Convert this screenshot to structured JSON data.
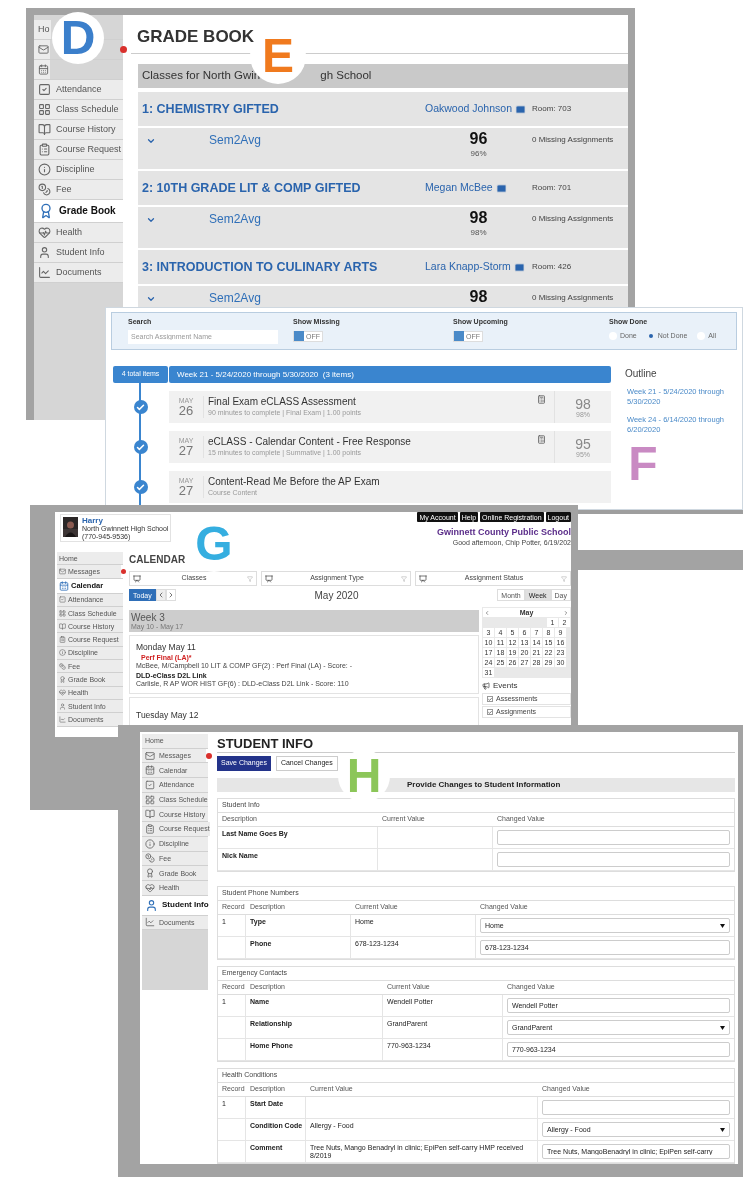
{
  "callouts": [
    {
      "letter": "D",
      "color": "#3b7fcb"
    },
    {
      "letter": "E",
      "color": "#f07a1e"
    },
    {
      "letter": "F",
      "color": "#c98ac3"
    },
    {
      "letter": "G",
      "color": "#35aee0"
    },
    {
      "letter": "H",
      "color": "#8cc659"
    }
  ],
  "gradebook": {
    "sidebar": [
      {
        "label": "Ho",
        "selected": false,
        "alert": false
      },
      {
        "selected": false,
        "alert": true
      },
      {
        "selected": false,
        "alert": false
      },
      {
        "label": "Attendance",
        "selected": false,
        "alert": false
      },
      {
        "label": "Class Schedule",
        "selected": false,
        "alert": false
      },
      {
        "label": "Course History",
        "selected": false,
        "alert": false
      },
      {
        "label": "Course Request",
        "selected": false,
        "alert": false
      },
      {
        "label": "Discipline",
        "selected": false,
        "alert": false
      },
      {
        "label": "Fee",
        "selected": false,
        "alert": false
      },
      {
        "label": "Grade Book",
        "selected": true,
        "alert": false
      },
      {
        "label": "Health",
        "selected": false,
        "alert": false
      },
      {
        "label": "Student Info",
        "selected": false,
        "alert": false
      },
      {
        "label": "Documents",
        "selected": false,
        "alert": false
      }
    ],
    "title": "GRADE BOOK",
    "header_parts": [
      "Classes for North Gwin",
      "gh School"
    ],
    "classes": [
      {
        "title": "1: CHEMISTRY GIFTED",
        "teacher": "Oakwood Johnson",
        "room": "Room: 703",
        "term": "Sem2Avg",
        "score": "96",
        "percent": "96%",
        "missing": "0 Missing Assignments"
      },
      {
        "title": "2: 10TH GRADE LIT & COMP GIFTED",
        "teacher": "Megan McBee",
        "room": "Room: 701",
        "term": "Sem2Avg",
        "score": "98",
        "percent": "98%",
        "missing": "0 Missing Assignments"
      },
      {
        "title": "3: INTRODUCTION TO CULINARY ARTS",
        "teacher": "Lara Knapp-Storm",
        "room": "Room: 426",
        "term": "Sem2Avg",
        "score": "98",
        "missing": "0 Missing Assignments"
      }
    ]
  },
  "assignments": {
    "search": {
      "label": "Search",
      "placeholder": "Search Assignment Name"
    },
    "toggles": [
      {
        "label": "Show Missing",
        "on": false,
        "text": "OFF"
      },
      {
        "label": "Show Upcoming",
        "on": false,
        "text": "OFF"
      }
    ],
    "show_done": {
      "label": "Show Done",
      "options": [
        {
          "label": "Done",
          "selected": false
        },
        {
          "label": "Not Done",
          "selected": true
        },
        {
          "label": "All",
          "selected": false
        }
      ]
    },
    "total_button": "4 total items",
    "week": "Week 21 - 5/24/2020 through 5/30/2020  (3 items)",
    "items": [
      {
        "month": "MAY",
        "day": "26",
        "title": "Final Exam eCLASS Assessment",
        "details": "90 minutes to complete | Final Exam | 1.00 points",
        "score": "98",
        "percent": "98%",
        "done": true
      },
      {
        "month": "MAY",
        "day": "27",
        "title": "eCLASS - Calendar Content - Free Response",
        "details": "15 minutes to complete | Summative | 1.00 points",
        "score": "95",
        "percent": "95%",
        "done": true
      },
      {
        "month": "MAY",
        "day": "27",
        "title": "Content-Read Me Before the AP Exam",
        "details": "Course Content",
        "done": true
      }
    ],
    "outline": {
      "title": "Outline",
      "links": [
        "Week 21 - 5/24/2020 through 5/30/2020",
        "Week 24 - 6/14/2020 through 6/20/2020"
      ]
    }
  },
  "calendar": {
    "user": {
      "name": "Harry",
      "school": "North Gwinnett High School",
      "phone": "(770-945-9536)"
    },
    "top_links": [
      "My Account",
      "Help",
      "Online Registration",
      "Logout"
    ],
    "district": "Gwinnett County Public School",
    "greeting": "Good afternoon, Chip Potter, 6/19/202",
    "sidebar": [
      {
        "label": "Home",
        "selected": false,
        "alert": false
      },
      {
        "label": "Messages",
        "selected": false,
        "alert": true
      },
      {
        "label": "Calendar",
        "selected": true,
        "alert": false
      },
      {
        "label": "Attendance",
        "selected": false,
        "alert": false
      },
      {
        "label": "Class Schedule",
        "selected": false,
        "alert": false
      },
      {
        "label": "Course History",
        "selected": false,
        "alert": false
      },
      {
        "label": "Course Request",
        "selected": false,
        "alert": false
      },
      {
        "label": "Discipline",
        "selected": false,
        "alert": false
      },
      {
        "label": "Fee",
        "selected": false,
        "alert": false
      },
      {
        "label": "Grade Book",
        "selected": false,
        "alert": false
      },
      {
        "label": "Health",
        "selected": false,
        "alert": false
      },
      {
        "label": "Student Info",
        "selected": false,
        "alert": false
      },
      {
        "label": "Documents",
        "selected": false,
        "alert": false
      }
    ],
    "title": "CALENDAR",
    "filters": [
      "Classes",
      "Assignment Type",
      "Assignment Status"
    ],
    "today": "Today",
    "month": "May 2020",
    "views": [
      {
        "label": "Month",
        "selected": false
      },
      {
        "label": "Week",
        "selected": true
      },
      {
        "label": "Day",
        "selected": false
      }
    ],
    "week": {
      "title": "Week 3",
      "range": "May 10 - May 17"
    },
    "days": [
      {
        "title": "Monday May 11",
        "events": [
          {
            "title": "Perf Final (LA)*",
            "detail": "McBee, M/Campbell 10 LIT & COMP GF(2) : Perf Final (LA) - Score: -",
            "flagged": true
          },
          {
            "title": "DLD-eClass D2L Link",
            "detail": "Carlisle, R AP WOR HIST GF(6) : DLD-eClass D2L Link - Score: 110",
            "flagged": false
          }
        ]
      },
      {
        "title": "Tuesday May 12"
      }
    ],
    "mini_calendar": {
      "month": "May",
      "weeks": [
        [
          "1",
          "2"
        ],
        [
          "3",
          "4",
          "5",
          "6",
          "7",
          "8",
          "9"
        ],
        [
          "10",
          "11",
          "12",
          "13",
          "14",
          "15",
          "16"
        ],
        [
          "17",
          "18",
          "19",
          "20",
          "21",
          "22",
          "23"
        ],
        [
          "24",
          "25",
          "26",
          "27",
          "28",
          "29",
          "30"
        ],
        [
          "31"
        ]
      ]
    },
    "events_panel": {
      "title": "Events",
      "filters": [
        {
          "label": "Assessments",
          "checked": true
        },
        {
          "label": "Assignments",
          "checked": true
        }
      ]
    }
  },
  "student_info": {
    "sidebar": [
      {
        "label": "Home",
        "selected": false,
        "alert": false
      },
      {
        "label": "Messages",
        "selected": false,
        "alert": true
      },
      {
        "label": "Calendar",
        "selected": false,
        "alert": false
      },
      {
        "label": "Attendance",
        "selected": false,
        "alert": false
      },
      {
        "label": "Class Schedule",
        "selected": false,
        "alert": false
      },
      {
        "label": "Course History",
        "selected": false,
        "alert": false
      },
      {
        "label": "Course Request",
        "selected": false,
        "alert": false
      },
      {
        "label": "Discipline",
        "selected": false,
        "alert": false
      },
      {
        "label": "Fee",
        "selected": false,
        "alert": false
      },
      {
        "label": "Grade Book",
        "selected": false,
        "alert": false
      },
      {
        "label": "Health",
        "selected": false,
        "alert": false
      },
      {
        "label": "Student Info",
        "selected": true,
        "alert": false
      },
      {
        "label": "Documents",
        "selected": false,
        "alert": false
      }
    ],
    "title": "STUDENT INFO",
    "buttons": [
      {
        "label": "Save Changes",
        "kind": "primary"
      },
      {
        "label": "Cancel Changes",
        "kind": "secondary"
      }
    ],
    "banner": "Provide Changes to Student Information",
    "sections": [
      {
        "title": "Student Info",
        "columns": [
          "Description",
          "Current Value",
          "Changed Value"
        ],
        "rows": [
          {
            "description": "Last Name Goes By",
            "field": {
              "kind": "input"
            }
          },
          {
            "description": "Nick Name",
            "field": {
              "kind": "input"
            }
          }
        ]
      },
      {
        "title": "Student Phone Numbers",
        "columns": [
          "Record",
          "Description",
          "Current Value",
          "Changed Value"
        ],
        "rows": [
          {
            "record": "1",
            "description": "Type",
            "current": "Home",
            "field": {
              "kind": "select",
              "value": "Home"
            }
          },
          {
            "description": "Phone",
            "current": "678-123-1234",
            "field": {
              "kind": "input",
              "value": "678-123-1234"
            }
          }
        ]
      },
      {
        "title": "Emergency Contacts",
        "columns": [
          "Record",
          "Description",
          "Current Value",
          "Changed Value"
        ],
        "rows": [
          {
            "record": "1",
            "description": "Name",
            "current": "Wendell Potter",
            "field": {
              "kind": "input",
              "value": "Wendell Potter"
            }
          },
          {
            "description": "Relationship",
            "current": "GrandParent",
            "field": {
              "kind": "select",
              "value": "GrandParent"
            }
          },
          {
            "description": "Home Phone",
            "current": "770-963-1234",
            "field": {
              "kind": "input",
              "value": "770-963-1234"
            }
          }
        ]
      },
      {
        "title": "Health Conditions",
        "columns": [
          "Record",
          "Description",
          "Current Value",
          "Changed Value"
        ],
        "rows": [
          {
            "record": "1",
            "description": "Start Date",
            "field": {
              "kind": "input"
            }
          },
          {
            "description": "Condition Code",
            "current": "Allergy - Food",
            "field": {
              "kind": "select",
              "value": "Allergy - Food"
            }
          },
          {
            "description": "Comment",
            "current": "Tree Nuts, Mango Benadryl in clinic; EpiPen self-carry HMP received 8/2019",
            "field": {
              "kind": "input",
              "value": "Tree Nuts, MangoBenadryl in clinic; EpiPen self-carry"
            }
          }
        ]
      }
    ]
  }
}
